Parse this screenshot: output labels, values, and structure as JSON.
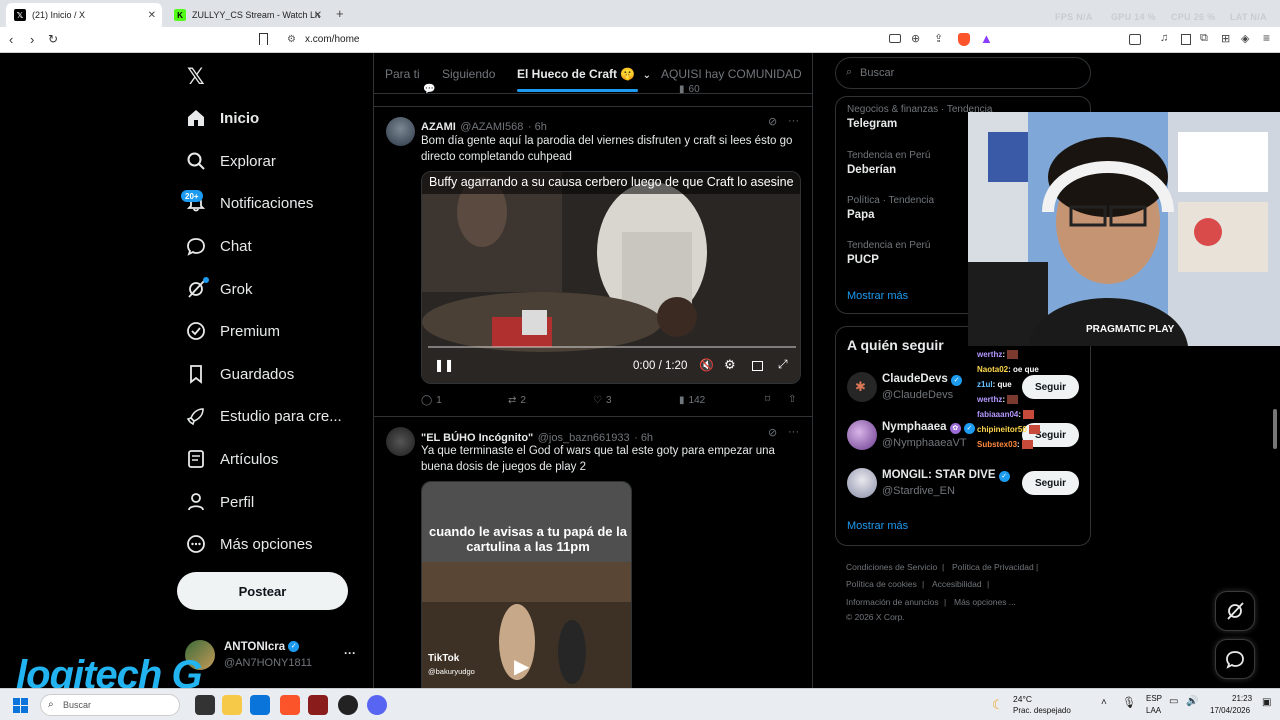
{
  "browser": {
    "tabs": [
      {
        "label": "(21) Inicio / X",
        "favicon": "x-logo-icon",
        "active": true
      },
      {
        "label": "ZULLYY_CS Stream - Watch Live o",
        "favicon": "kick-logo-icon",
        "active": false
      }
    ],
    "new_tab": "+",
    "url": "x.com/home",
    "perf": {
      "fps_label": "FPS",
      "fps": "N/A",
      "gpu_label": "GPU",
      "gpu": "14 %",
      "cpu_label": "CPU",
      "cpu": "26 %",
      "lat_label": "LAT",
      "lat": "N/A"
    }
  },
  "sidebar": {
    "items": [
      {
        "label": "Inicio",
        "icon": "home-icon",
        "active": true
      },
      {
        "label": "Explorar",
        "icon": "search-icon"
      },
      {
        "label": "Notificaciones",
        "icon": "bell-icon",
        "badge": "20+"
      },
      {
        "label": "Chat",
        "icon": "chat-icon"
      },
      {
        "label": "Grok",
        "icon": "grok-icon"
      },
      {
        "label": "Premium",
        "icon": "premium-icon"
      },
      {
        "label": "Guardados",
        "icon": "bookmark-icon"
      },
      {
        "label": "Estudio para cre...",
        "icon": "rocket-icon"
      },
      {
        "label": "Artículos",
        "icon": "article-icon"
      },
      {
        "label": "Perfil",
        "icon": "person-icon"
      },
      {
        "label": "Más opciones",
        "icon": "more-circle-icon"
      }
    ],
    "post_button": "Postear",
    "account": {
      "name": "ANTONIcra",
      "handle": "@AN7HONY1811",
      "more": "···"
    }
  },
  "feed": {
    "tabs": [
      {
        "label": "Para ti"
      },
      {
        "label": "Siguiendo"
      },
      {
        "label": "El Hueco de Craft 🤫",
        "active": true
      },
      {
        "label": "AQUISI hay COMUNIDAD"
      }
    ],
    "prev_post_actions": {
      "reply": "",
      "repost": "",
      "like": "",
      "views": "60"
    },
    "posts": [
      {
        "name": "AZAMI",
        "handle": "@AZAMI568",
        "time": "· 6h",
        "text": "Bom día gente aquí la parodia del viernes disfruten y craft si lees ésto go directo completando cuhpead",
        "video_caption": "Buffy agarrando a su causa cerbero luego de que Craft lo asesine",
        "video_time": "0:00 / 1:20",
        "video_progress": 0.0,
        "actions": {
          "reply": "1",
          "repost": "2",
          "like": "3",
          "views": "142"
        }
      },
      {
        "name": "\"EL BÚHO Incógnito\"",
        "handle": "@jos_bazn661933",
        "time": "· 6h",
        "text": "Ya que terminaste el God of wars que tal este goty para empezar una buena dosis de juegos de play 2",
        "video_caption": "cuando le avisas a tu papá de la cartulina a las 11pm",
        "watermark": "TikTok",
        "watermark_handle": "@bakuryudgo"
      }
    ]
  },
  "right": {
    "search_placeholder": "Buscar",
    "trends": [
      {
        "meta": "Negocios & finanzas · Tendencia",
        "name": "Telegram"
      },
      {
        "meta": "Tendencia en Perú",
        "name": "Deberían"
      },
      {
        "meta": "Política · Tendencia",
        "name": "Papa"
      },
      {
        "meta": "Tendencia en Perú",
        "name": "PUCP"
      }
    ],
    "show_more": "Mostrar más",
    "who_to_follow_title": "A quién seguir",
    "suggestions": [
      {
        "name": "ClaudeDevs",
        "handle": "@ClaudeDevs",
        "button": "Seguir"
      },
      {
        "name": "Nymphaaea",
        "handle": "@NymphaaeaVT",
        "button": "Seguir"
      },
      {
        "name": "MONGIL: STAR DIVE",
        "handle": "@Stardive_EN",
        "button": "Seguir"
      }
    ],
    "show_more_2": "Mostrar más",
    "footer": [
      "Condiciones de Servicio",
      "|",
      "Política de Privacidad",
      "|",
      "Política de cookies",
      "|",
      "Accesibilidad",
      "|",
      "Información de anuncios",
      "|",
      "Más opciones ...",
      "© 2026 X Corp."
    ]
  },
  "stream_overlay": {
    "webcam_brand": "PRAGMATIC PLAY",
    "chat": [
      {
        "user": "werthz",
        "msg": ":",
        "color": "#b497ff"
      },
      {
        "user": "Naota02",
        "msg": ": oe que",
        "color": "#ffd84d"
      },
      {
        "user": "z1ul",
        "msg": ": que",
        "color": "#66c2ff"
      },
      {
        "user": "werthz",
        "msg": ":",
        "color": "#b497ff"
      },
      {
        "user": "fabiaaan04",
        "msg": ":",
        "color": "#b497ff"
      },
      {
        "user": "chipineitor50",
        "msg": "",
        "color": "#ffd84d"
      },
      {
        "user": "Substex03",
        "msg": ":",
        "color": "#ff8a3d"
      }
    ],
    "logo_text": "logitech G"
  },
  "taskbar": {
    "search_placeholder": "Buscar",
    "weather_temp": "24°C",
    "weather_desc": "Prac. despejado",
    "lang": "ESP",
    "lang_sub": "LAA",
    "time": "21:23",
    "date": "17/04/2026"
  }
}
